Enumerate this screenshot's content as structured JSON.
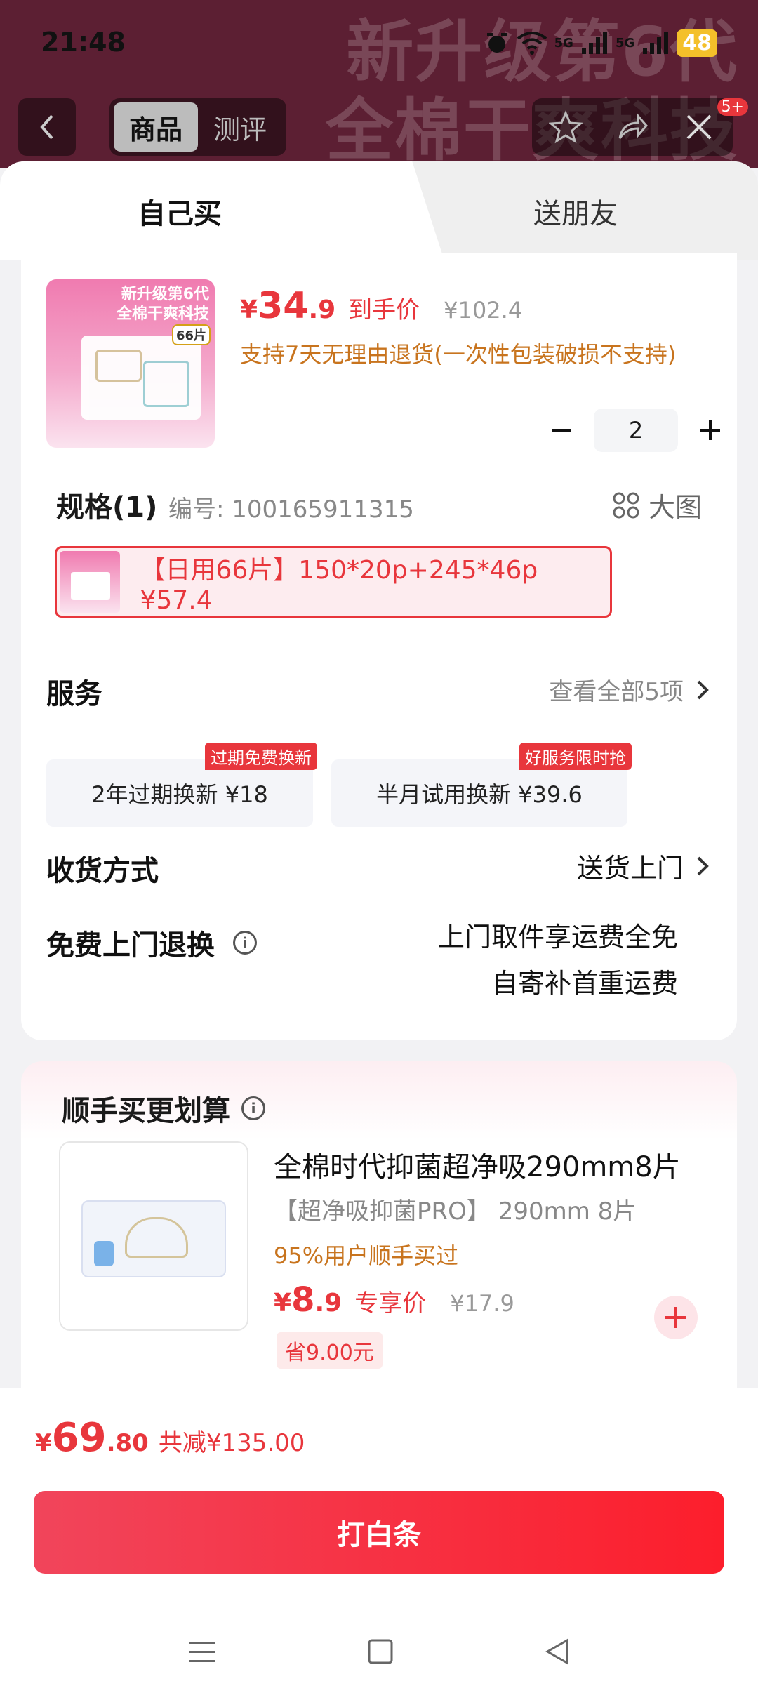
{
  "status_bar": {
    "time": "21:48",
    "battery": "48",
    "signal_labels": [
      "5G",
      "5G"
    ]
  },
  "background": {
    "overlay_text_line1": "新升级第6代",
    "overlay_text_line2": "全棉干爽科技"
  },
  "top_nav": {
    "tabs": [
      "商品",
      "测评"
    ],
    "badge": "5+"
  },
  "mode_tabs": {
    "self": "自己买",
    "gift": "送朋友"
  },
  "product": {
    "image_title_line1": "新升级第6代",
    "image_title_line2": "全棉干爽科技",
    "image_badge": "66片",
    "price_symbol": "¥",
    "price_int": "34",
    "price_dec": ".9",
    "price_tag": "到手价",
    "original_price": "¥102.4",
    "return_policy": "支持7天无理由退货(一次性包装破损不支持)",
    "quantity": "2"
  },
  "spec": {
    "title": "规格(1)",
    "code": "编号: 100165911315",
    "big_image_label": "大图",
    "selected_option": "【日用66片】150*20p+245*46p  ¥57.4"
  },
  "service": {
    "title": "服务",
    "view_all": "查看全部5项",
    "items": [
      {
        "label": "2年过期换新  ¥18",
        "badge": "过期免费换新"
      },
      {
        "label": "半月试用换新  ¥39.6",
        "badge": "好服务限时抢"
      }
    ]
  },
  "delivery": {
    "title": "收货方式",
    "value": "送货上门"
  },
  "free_return": {
    "title": "免费上门退换",
    "line1": "上门取件享运费全免",
    "line2": "自寄补首重运费"
  },
  "combo": {
    "title": "顺手买更划算",
    "name": "全棉时代抑菌超净吸290mm8片",
    "spec": "【超净吸抑菌PRO】 290mm 8片",
    "bought": "95%用户顺手买过",
    "price_symbol": "¥",
    "price_int": "8",
    "price_dec": ".9",
    "price_tag": "专享价",
    "original_price": "¥17.9",
    "save": "省9.00元"
  },
  "bottom": {
    "total_symbol": "¥",
    "total_int": "69",
    "total_dec": ".80",
    "reduce": "共减¥135.00",
    "pay_button": "打白条"
  },
  "colors": {
    "accent": "#e8363c",
    "orange_text": "#c8741e",
    "header_bg": "#5c1f33"
  },
  "icons": [
    "back-icon",
    "star-icon",
    "share-icon",
    "more-icon",
    "close-icon",
    "grid-icon",
    "info-icon",
    "chevron-right-icon",
    "plus-icon",
    "minus-icon",
    "menu-icon",
    "home-icon",
    "back-triangle-icon"
  ]
}
